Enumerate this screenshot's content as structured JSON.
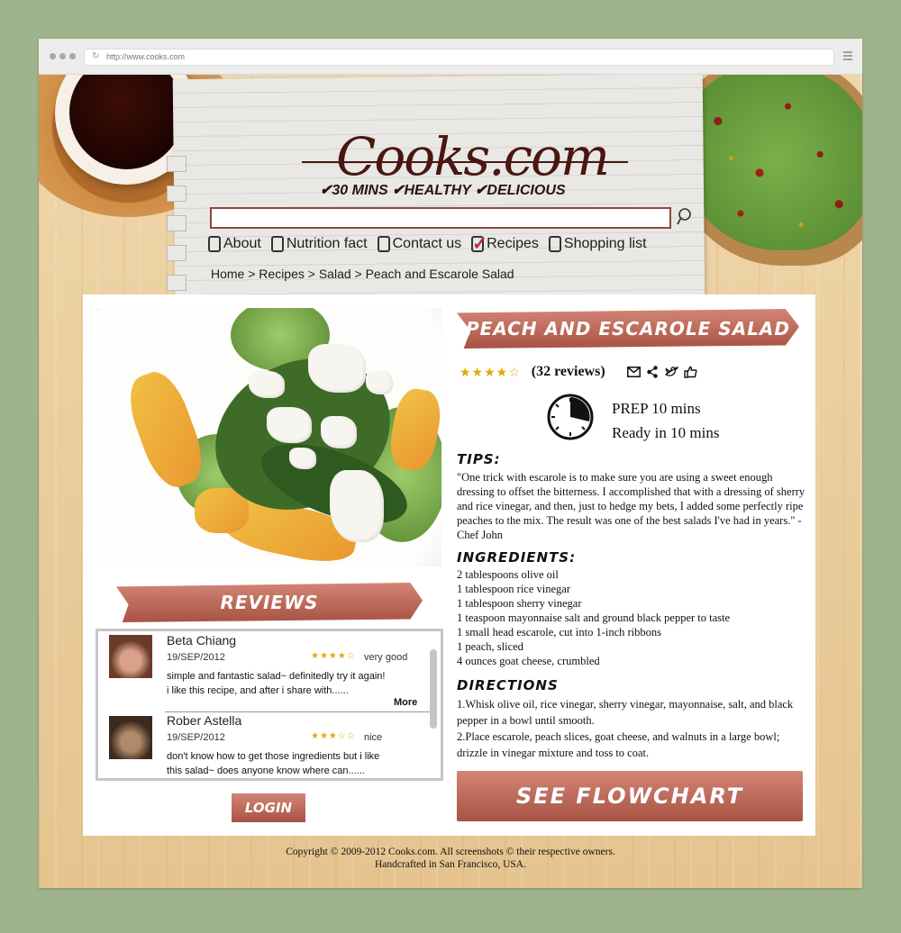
{
  "browser": {
    "url": "http://www.cooks.com"
  },
  "header": {
    "logo": "Cooks.com",
    "tagline": "✔30 MINS  ✔HEALTHY  ✔DELICIOUS",
    "search": {
      "value": "",
      "placeholder": ""
    },
    "nav": [
      {
        "label": "About",
        "checked": false
      },
      {
        "label": "Nutrition fact",
        "checked": false
      },
      {
        "label": "Contact us",
        "checked": false
      },
      {
        "label": "Recipes",
        "checked": true
      },
      {
        "label": "Shopping list",
        "checked": false
      }
    ],
    "breadcrumb": "Home > Recipes > Salad  > Peach and Escarole Salad"
  },
  "reviews": {
    "heading": "REVIEWS",
    "items": [
      {
        "name": "Beta Chiang",
        "date": "19/SEP/2012",
        "stars": "★★★★☆",
        "rating": 4,
        "verdict": "very good",
        "text_line1": "simple and fantastic salad~ definitedly try it again!",
        "text_line2": "i like this recipe, and after i share with......",
        "more": "More"
      },
      {
        "name": "Rober Astella",
        "date": "19/SEP/2012",
        "stars": "★★★☆☆",
        "rating": 3,
        "verdict": "nice",
        "text_line1": "don't know how to get those ingredients but i like",
        "text_line2": "this salad~ does anyone know where can......"
      }
    ],
    "login_label": "LOGIN"
  },
  "recipe": {
    "title": "PEACH AND ESCAROLE SALAD",
    "stars": "★★★★☆",
    "rating": 4,
    "reviews_count": "(32 reviews)",
    "prep": "PREP 10 mins",
    "ready": "Ready in 10 mins",
    "tips_heading": "TIPS",
    "tips_text": "\"One trick with escarole is to make sure you are using a sweet enough dressing to offset the bitterness. I accomplished that with a dressing of sherry and rice vinegar, and then, just to hedge my bets, I added some perfectly ripe peaches to the mix. The result was one of the best salads I've had in years.\" - Chef John",
    "ingredients_heading": "INGREDIENTS",
    "ingredients": [
      "2 tablespoons olive oil",
      "1 tablespoon rice vinegar",
      "1 tablespoon sherry vinegar",
      "1 teaspoon mayonnaise salt and ground black pepper to taste",
      "1 small head escarole, cut into 1-inch ribbons",
      "1 peach, sliced",
      "4 ounces goat cheese, crumbled"
    ],
    "directions_heading": "DIRECTIONS",
    "directions": [
      "1.Whisk olive oil, rice vinegar, sherry vinegar, mayonnaise, salt, and black pepper in a bowl until smooth.",
      "2.Place escarole, peach slices, goat cheese, and walnuts in a large bowl; drizzle in vinegar mixture and toss to coat."
    ],
    "flowchart_label": "SEE FLOWCHART"
  },
  "footer": {
    "line1": "Copyright © 2009-2012 Cooks.com. All screenshots © their respective owners.",
    "line2": "Handcrafted in San Francisco, USA."
  },
  "icons": {
    "coffee": "coffee-cup-icon",
    "toast": "guacamole-toast-icon",
    "search": "search-icon",
    "clock": "clock-icon",
    "email": "email-icon",
    "share": "share-icon",
    "twitter": "twitter-bird-icon",
    "like": "thumbs-up-icon"
  },
  "colors": {
    "accent": "#b8604f",
    "brand_text": "#4a160f",
    "star": "#e0a800",
    "background": "#9fb38c"
  }
}
